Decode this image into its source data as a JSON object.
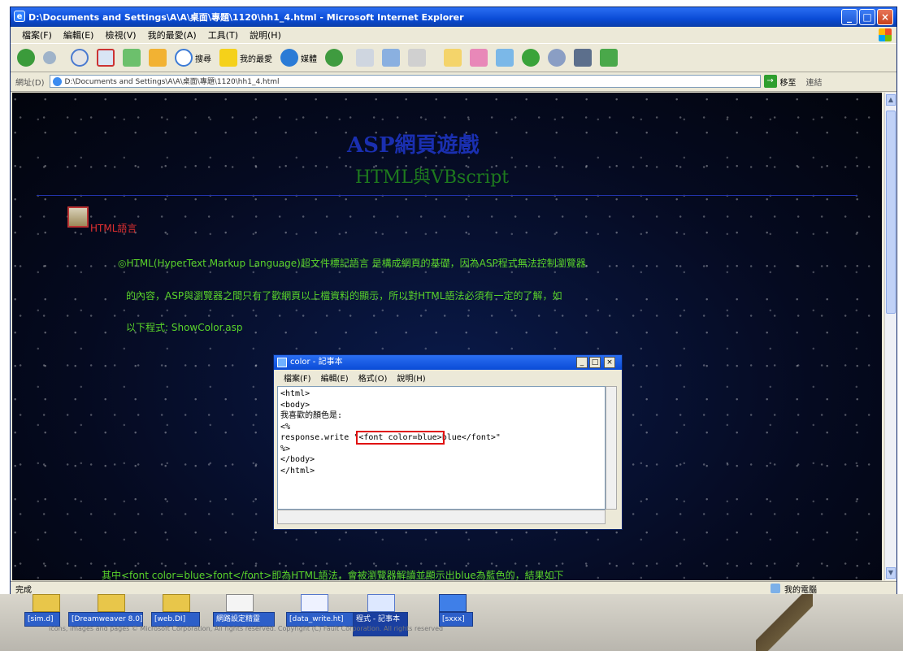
{
  "window": {
    "title": "D:\\Documents and Settings\\A\\A\\桌面\\專題\\1120\\hh1_4.html - Microsoft Internet Explorer",
    "menu": [
      "檔案(F)",
      "編輯(E)",
      "檢視(V)",
      "我的最愛(A)",
      "工具(T)",
      "說明(H)"
    ]
  },
  "toolbar": {
    "back": "上一頁",
    "search": "搜尋",
    "favorites": "我的最愛",
    "media": "媒體"
  },
  "address": {
    "label": "網址(D)",
    "value": "D:\\Documents and Settings\\A\\A\\桌面\\專題\\1120\\hh1_4.html",
    "go": "移至",
    "links": "連結"
  },
  "page": {
    "title": "ASP網頁遊戲",
    "subtitle": "HTML與VBscript",
    "section": "HTML語言",
    "para1": "◎HTML(HyperText Markup Language)超文件標記語言 是構成網頁的基礎，因為ASP程式無法控制瀏覽器",
    "para2": "的內容，ASP與瀏覽器之間只有了歡網頁以上檔資料的顯示，所以對HTML語法必須有一定的了解，如",
    "para3": "以下程式: ShowColor.asp",
    "bottom": "其中<font color=blue>font</font>即為HTML語法，會被瀏覽器解讀並顯示出blue為藍色的，結果如下"
  },
  "notepad": {
    "title": "color - 記事本",
    "menu": [
      "檔案(F)",
      "編輯(E)",
      "格式(O)",
      "說明(H)"
    ],
    "lines": [
      "<html>",
      "<body>",
      "我喜歡的顏色是:",
      "<%",
      "response.write \"",
      "%>",
      "</body>",
      "</html>"
    ],
    "highlight": "<font color=blue>",
    "after": "blue</font>\""
  },
  "status": {
    "left": "完成",
    "right": "我的電腦"
  },
  "taskbar": {
    "items": [
      "[sim.d]",
      "[Dreamweaver 8.0]",
      "[web.DI]",
      "網路設定精靈",
      "[data_write.ht]",
      "程式 - 記事本",
      "[sxxx]"
    ],
    "footer": "Icons, images and pages © Microsoft Corporation, All rights reserved. Copyright (C) Fault Corporation. All rights reserved"
  },
  "colors": {
    "title_bar": "#0a4bd6",
    "heading": "#1a2fb0",
    "green_text": "#5ad42a",
    "red_text": "#e03030",
    "highlight": "#e01010"
  }
}
